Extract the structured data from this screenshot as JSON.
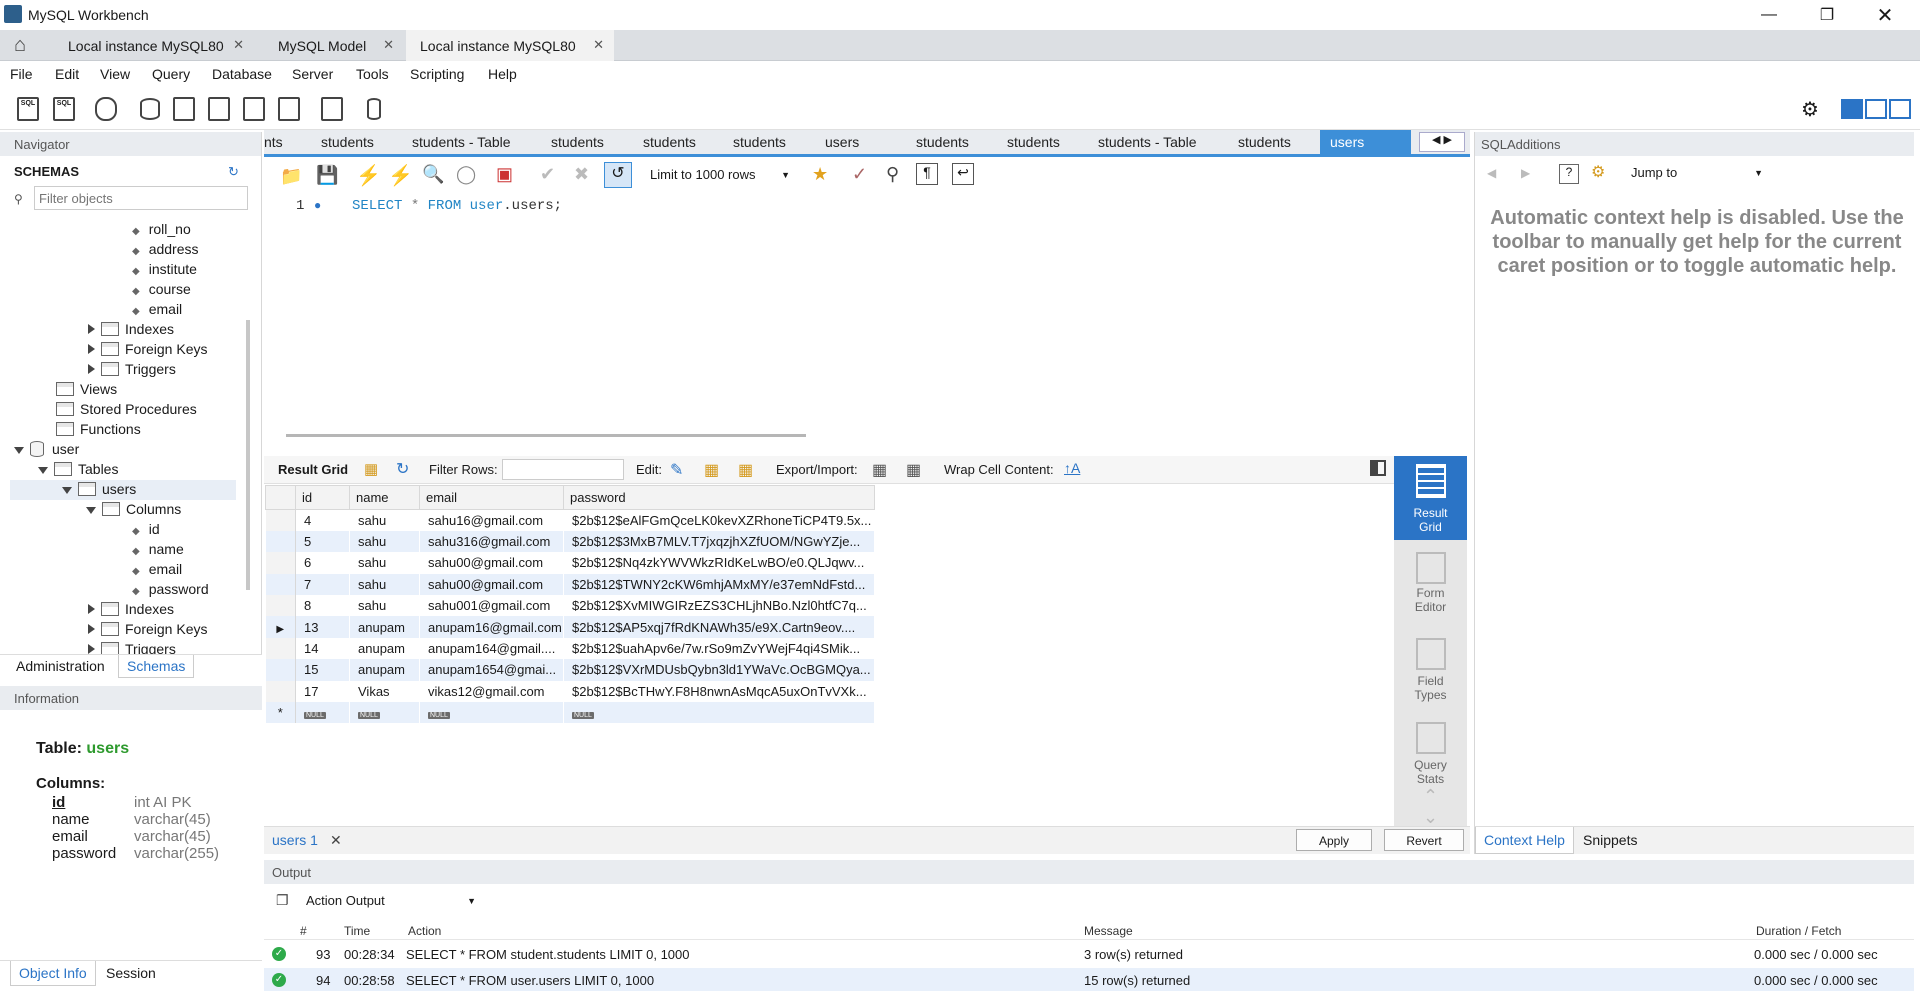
{
  "window": {
    "title": "MySQL Workbench"
  },
  "main_tabs": [
    {
      "label": "Local instance MySQL80"
    },
    {
      "label": "MySQL Model"
    },
    {
      "label": "Local instance MySQL80"
    }
  ],
  "menu": [
    "File",
    "Edit",
    "View",
    "Query",
    "Database",
    "Server",
    "Tools",
    "Scripting",
    "Help"
  ],
  "navigator": {
    "header": "Navigator",
    "schemas_label": "SCHEMAS",
    "filter_placeholder": "Filter objects",
    "tree": [
      {
        "label": "roll_no"
      },
      {
        "label": "address"
      },
      {
        "label": "institute"
      },
      {
        "label": "course"
      },
      {
        "label": "email"
      },
      {
        "label": "Indexes"
      },
      {
        "label": "Foreign Keys"
      },
      {
        "label": "Triggers"
      },
      {
        "label": "Views"
      },
      {
        "label": "Stored Procedures"
      },
      {
        "label": "Functions"
      },
      {
        "label": "user"
      },
      {
        "label": "Tables"
      },
      {
        "label": "users"
      },
      {
        "label": "Columns"
      },
      {
        "label": "id"
      },
      {
        "label": "name"
      },
      {
        "label": "email"
      },
      {
        "label": "password"
      },
      {
        "label": "Indexes"
      },
      {
        "label": "Foreign Keys"
      },
      {
        "label": "Triggers"
      }
    ],
    "bottom_tabs": [
      "Administration",
      "Schemas"
    ]
  },
  "information": {
    "header": "Information",
    "table_label": "Table:",
    "table_name": "users",
    "columns_label": "Columns:",
    "columns": [
      {
        "name": "id",
        "type": "int AI PK"
      },
      {
        "name": "name",
        "type": "varchar(45)"
      },
      {
        "name": "email",
        "type": "varchar(45)"
      },
      {
        "name": "password",
        "type": "varchar(255)"
      }
    ],
    "bottom_tabs": [
      "Object Info",
      "Session"
    ]
  },
  "editor_tabs": [
    "nts",
    "students",
    "students - Table",
    "students",
    "students",
    "students",
    "users",
    "students",
    "students",
    "students - Table",
    "students",
    "users"
  ],
  "editor_toolbar": {
    "limit_label": "Limit to 1000 rows"
  },
  "code": {
    "line_no": "1",
    "tokens": [
      "SELECT",
      "*",
      "FROM",
      "user",
      ".users;"
    ]
  },
  "result_toolbar": {
    "result_grid": "Result Grid",
    "filter_rows": "Filter Rows:",
    "edit": "Edit:",
    "export_import": "Export/Import:",
    "wrap": "Wrap Cell Content:"
  },
  "grid": {
    "columns": [
      "id",
      "name",
      "email",
      "password"
    ],
    "rows": [
      [
        "4",
        "sahu",
        "sahu16@gmail.com",
        "$2b$12$eAlFGmQceLK0kevXZRhoneTiCP4T9.5x..."
      ],
      [
        "5",
        "sahu",
        "sahu316@gmail.com",
        "$2b$12$3MxB7MLV.T7jxqzjhXZfUOM/NGwYZje..."
      ],
      [
        "6",
        "sahu",
        "sahu00@gmail.com",
        "$2b$12$Nq4zkYWVWkzRIdKeLwBO/e0.QLJqwv..."
      ],
      [
        "7",
        "sahu",
        "sahu00@gmail.com",
        "$2b$12$TWNY2cKW6mhjAMxMY/e37emNdFstd..."
      ],
      [
        "8",
        "sahu",
        "sahu001@gmail.com",
        "$2b$12$XvMIWGIRzEZS3CHLjhNBo.Nzl0htfC7q..."
      ],
      [
        "13",
        "anupam",
        "anupam16@gmail.com",
        "$2b$12$AP5xqj7fRdKNAWh35/e9X.Cartn9eov...."
      ],
      [
        "14",
        "anupam",
        "anupam164@gmail....",
        "$2b$12$uahApv6e/7w.rSo9mZvYWejF4qi4SMik..."
      ],
      [
        "15",
        "anupam",
        "anupam1654@gmai...",
        "$2b$12$VXrMDUsbQybn3ld1YWaVc.OcBGMQya..."
      ],
      [
        "17",
        "Vikas",
        "vikas12@gmail.com",
        "$2b$12$BcTHwY.F8H8nwnAsMqcA5uxOnTvVXk..."
      ]
    ],
    "null_label": "NULL",
    "new_marker": "*"
  },
  "side_panel": [
    "Result Grid",
    "Form Editor",
    "Field Types",
    "Query Stats"
  ],
  "result_tab": "users 1",
  "apply_label": "Apply",
  "revert_label": "Revert",
  "sql_additions": {
    "header": "SQLAdditions",
    "jump_to": "Jump to",
    "help_text": "Automatic context help is disabled. Use the toolbar to manually get help for the current caret position or to toggle automatic help.",
    "tabs": [
      "Context Help",
      "Snippets"
    ]
  },
  "output": {
    "header": "Output",
    "mode": "Action Output",
    "columns": [
      "#",
      "Time",
      "Action",
      "Message",
      "Duration / Fetch"
    ],
    "rows": [
      {
        "num": "93",
        "time": "00:28:34",
        "action": "SELECT * FROM student.students LIMIT 0, 1000",
        "message": "3 row(s) returned",
        "duration": "0.000 sec / 0.000 sec"
      },
      {
        "num": "94",
        "time": "00:28:58",
        "action": "SELECT * FROM user.users LIMIT 0, 1000",
        "message": "15 row(s) returned",
        "duration": "0.000 sec / 0.000 sec"
      }
    ]
  }
}
